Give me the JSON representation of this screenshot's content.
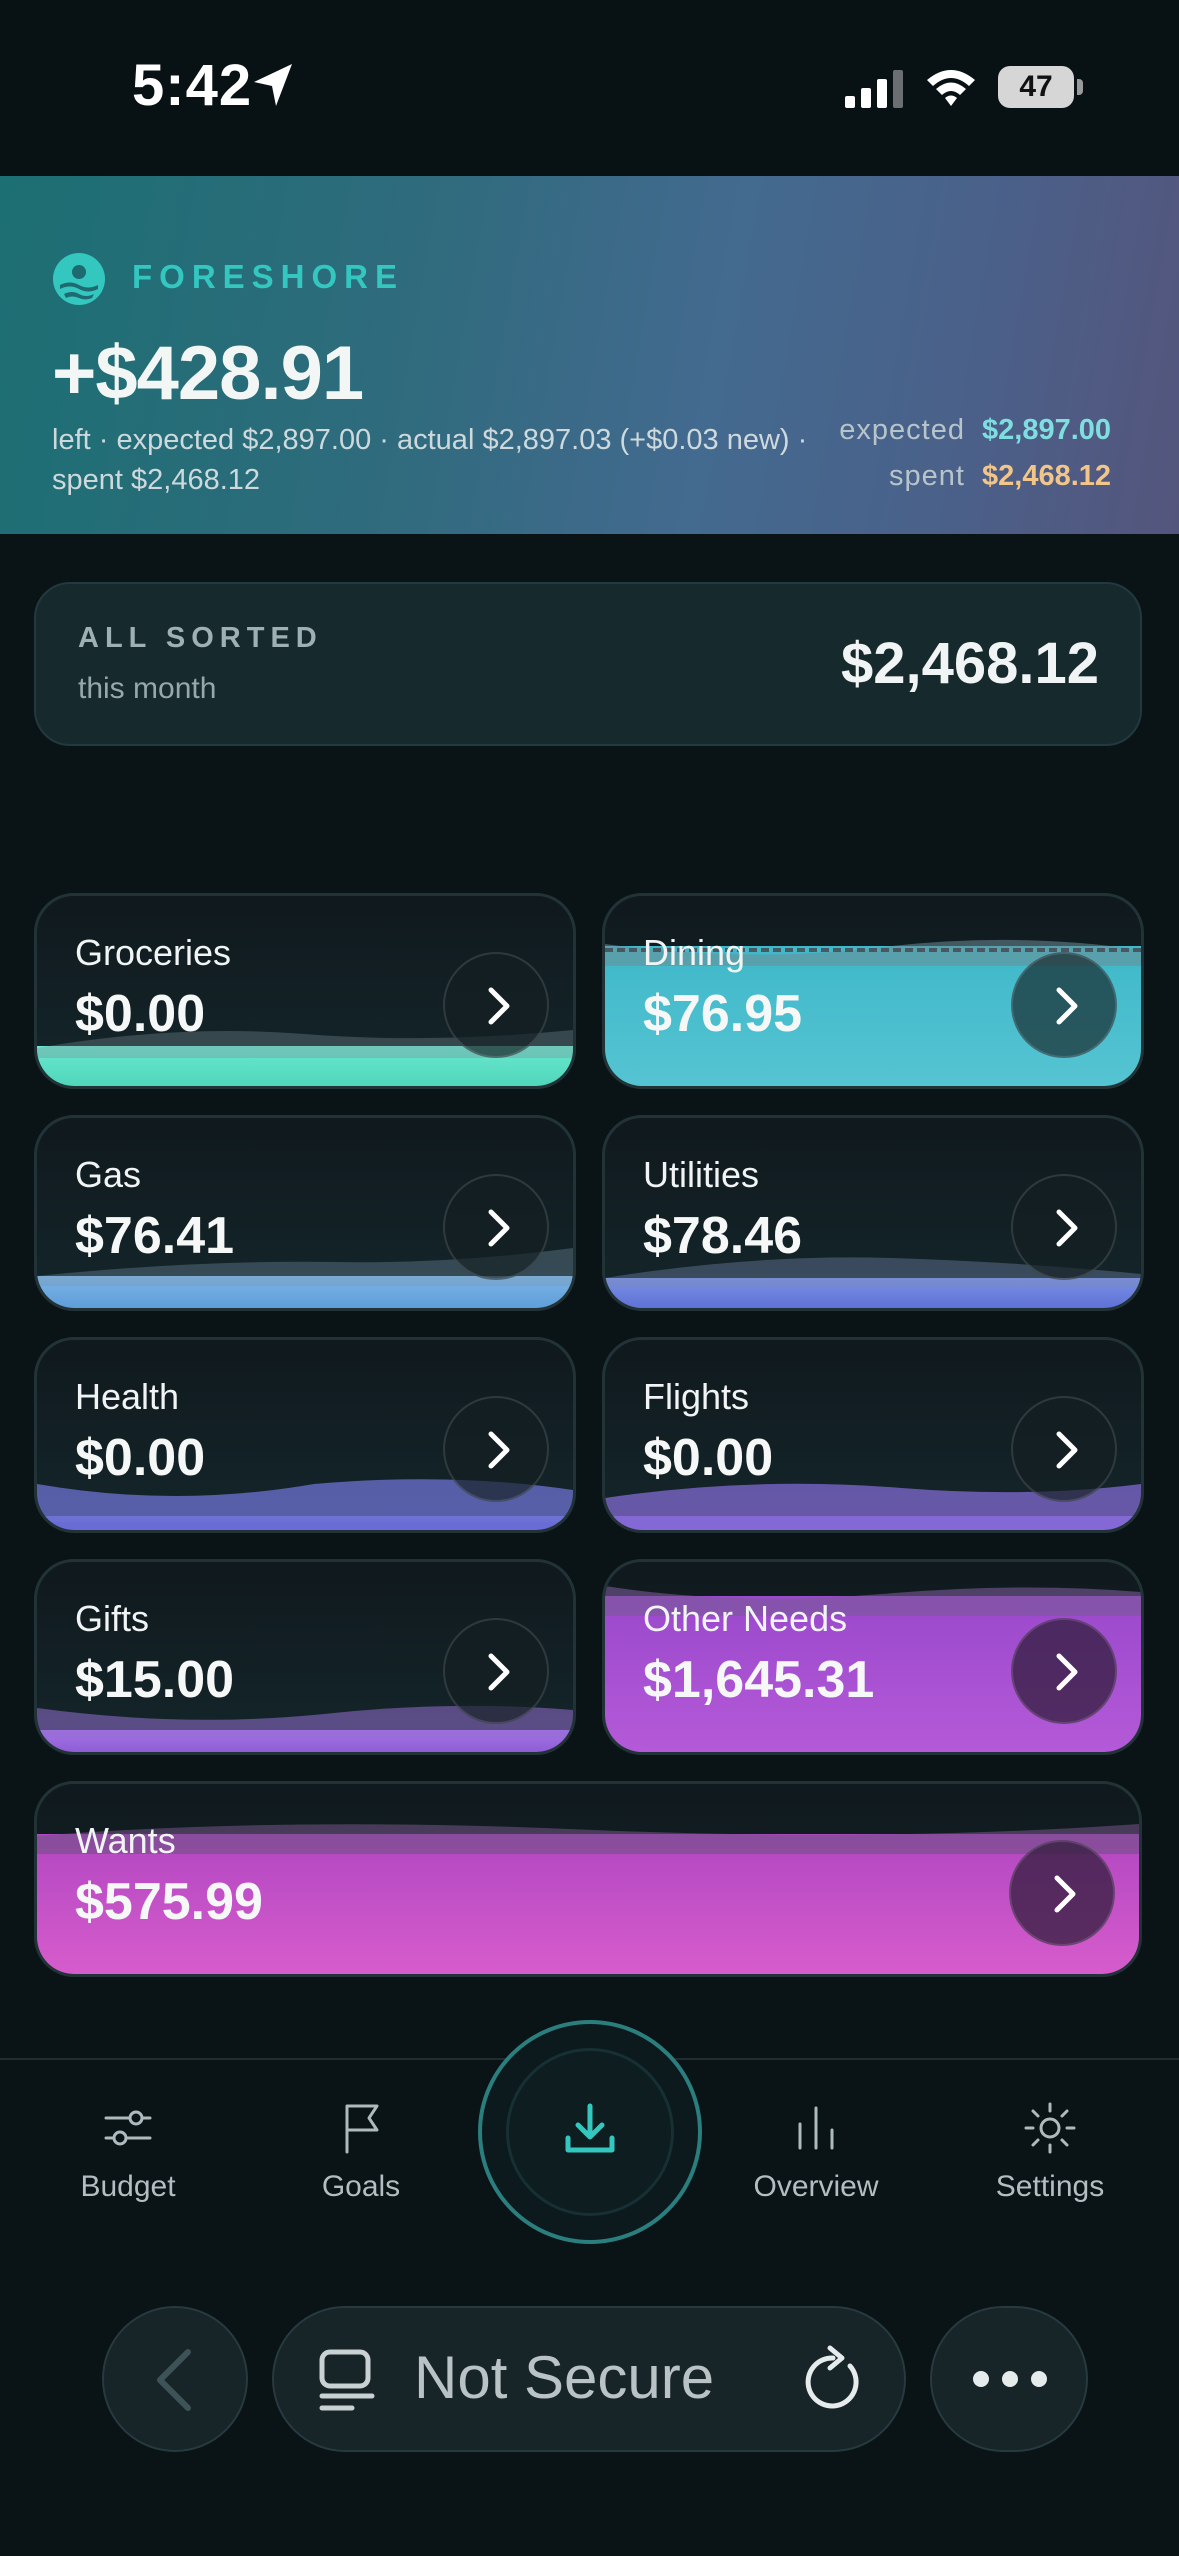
{
  "status_bar": {
    "time": "5:42",
    "battery": "47"
  },
  "header": {
    "brand": "FORESHORE",
    "balance": "+$428.91",
    "summary": "left · expected $2,897.00 · actual $2,897.03 (+$0.03 new) · spent $2,468.12",
    "expected_label": "expected",
    "expected_value": "$2,897.00",
    "spent_label": "spent",
    "spent_value": "$2,468.12"
  },
  "sorted_card": {
    "title": "ALL SORTED",
    "subtitle": "this month",
    "amount": "$2,468.12"
  },
  "categories": [
    {
      "name": "Groceries",
      "amount": "$0.00",
      "color": "#5fe0c4"
    },
    {
      "name": "Dining",
      "amount": "$76.95",
      "color": "#4bbfd0"
    },
    {
      "name": "Gas",
      "amount": "$76.41",
      "color": "#6aa9e0"
    },
    {
      "name": "Utilities",
      "amount": "$78.46",
      "color": "#6a84e0"
    },
    {
      "name": "Health",
      "amount": "$0.00",
      "color": "#6f72d9"
    },
    {
      "name": "Flights",
      "amount": "$0.00",
      "color": "#8a6ed8"
    },
    {
      "name": "Gifts",
      "amount": "$15.00",
      "color": "#9b6ae0"
    },
    {
      "name": "Other Needs",
      "amount": "$1,645.31",
      "color": "#a64fd2"
    },
    {
      "name": "Wants",
      "amount": "$575.99",
      "color": "#c954c9"
    }
  ],
  "nav": {
    "budget": "Budget",
    "goals": "Goals",
    "overview": "Overview",
    "settings": "Settings"
  },
  "browser": {
    "url_text": "Not Secure"
  },
  "colors": {
    "background": "#0a1316",
    "brand_teal": "#34c7c0",
    "expected_color": "#7fdfe0",
    "spent_color": "#f2c589"
  }
}
